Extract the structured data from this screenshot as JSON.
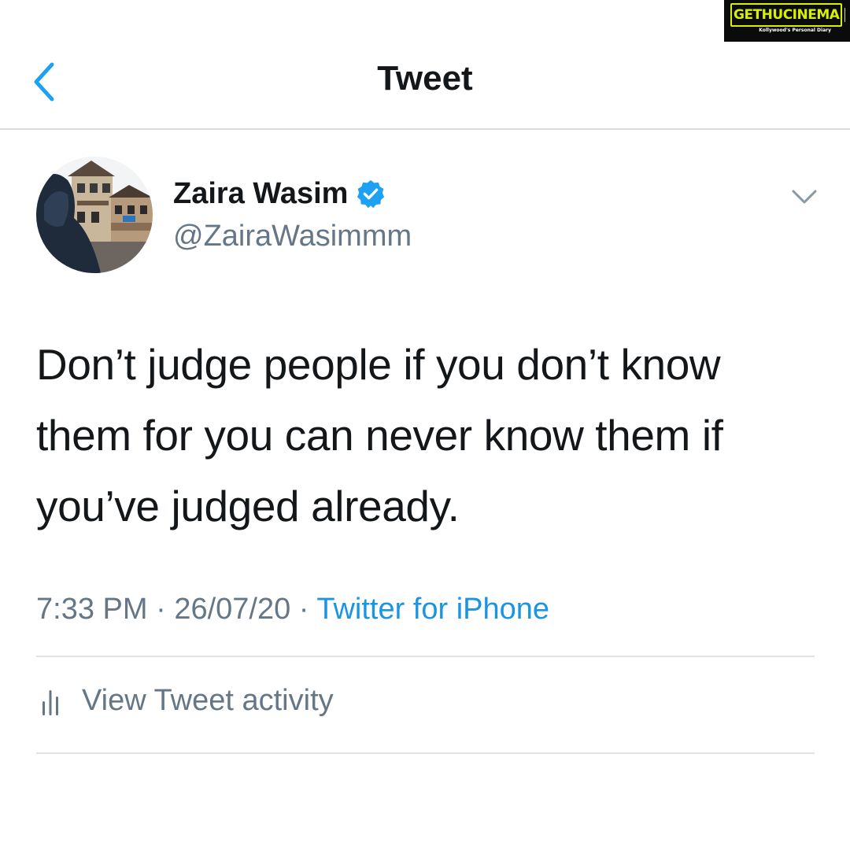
{
  "watermark": {
    "brand": "GETHUCINEMA",
    "tagline": "Kollywood's Personal Diary"
  },
  "header": {
    "title": "Tweet",
    "back_icon": "chevron-left-icon"
  },
  "tweet": {
    "author": {
      "display_name": "Zaira Wasim",
      "handle": "@ZairaWasimmm",
      "verified": true
    },
    "text": "Don’t judge people if you don’t know them for you can never know them if you’ve judged already.",
    "time": "7:33 PM",
    "separator": " · ",
    "date": "26/07/20",
    "source": "Twitter for iPhone"
  },
  "activity": {
    "label": "View Tweet activity",
    "icon": "bar-chart-icon"
  },
  "colors": {
    "accent": "#1b95e0",
    "verified": "#1da1f2",
    "text_primary": "#14171a",
    "text_secondary": "#657786",
    "divider": "#dfe3e7"
  }
}
